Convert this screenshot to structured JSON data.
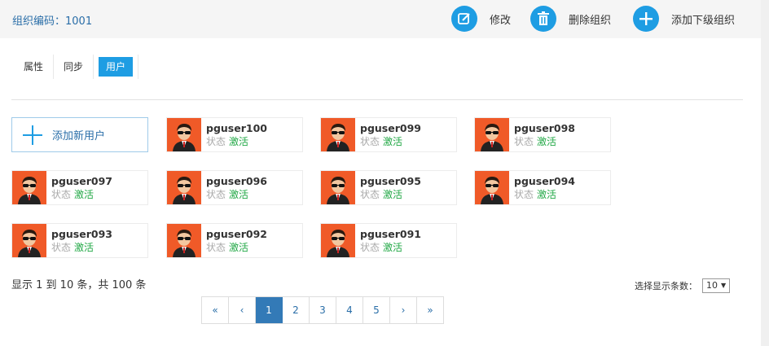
{
  "header": {
    "org_code": "组织编码：1001",
    "actions": [
      {
        "label": "修改",
        "icon": "edit-icon"
      },
      {
        "label": "删除组织",
        "icon": "trash-icon"
      },
      {
        "label": "添加下级组织",
        "icon": "plus-icon"
      }
    ]
  },
  "tabs": [
    {
      "label": "属性",
      "active": false
    },
    {
      "label": "同步",
      "active": false
    },
    {
      "label": "用户",
      "active": true
    }
  ],
  "add_user": {
    "label": "添加新用户",
    "icon": "plus-icon"
  },
  "status_label": "状态",
  "users": [
    {
      "name": "pguser100",
      "status": "激活"
    },
    {
      "name": "pguser099",
      "status": "激活"
    },
    {
      "name": "pguser098",
      "status": "激活"
    },
    {
      "name": "pguser097",
      "status": "激活"
    },
    {
      "name": "pguser096",
      "status": "激活"
    },
    {
      "name": "pguser095",
      "status": "激活"
    },
    {
      "name": "pguser094",
      "status": "激活"
    },
    {
      "name": "pguser093",
      "status": "激活"
    },
    {
      "name": "pguser092",
      "status": "激活"
    },
    {
      "name": "pguser091",
      "status": "激活"
    }
  ],
  "summary": "显示 1 到 10 条，共 100 条",
  "page_size": {
    "label": "选择显示条数：",
    "value": "10"
  },
  "pagination": {
    "first": "«",
    "prev": "‹",
    "next": "›",
    "last": "»",
    "pages": [
      "1",
      "2",
      "3",
      "4",
      "5"
    ],
    "current": "1"
  },
  "colors": {
    "accent": "#1e9de3",
    "status_active": "#22a846",
    "avatar_bg": "#f05a28"
  }
}
